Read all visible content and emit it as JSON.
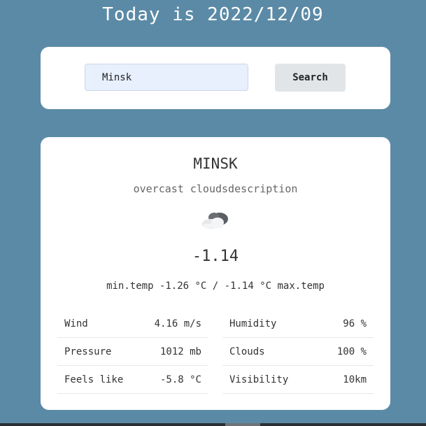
{
  "header": {
    "title": "Today is 2022/12/09"
  },
  "search": {
    "value": "Minsk",
    "placeholder": "",
    "button_label": "Search"
  },
  "weather": {
    "city": "MINSK",
    "description": "overcast cloudsdescription",
    "icon": "cloud-icon",
    "temperature": "-1.14",
    "minmax": "min.temp -1.26 °C / -1.14 °C max.temp"
  },
  "details": {
    "left": [
      {
        "label": "Wind",
        "value": "4.16 m/s"
      },
      {
        "label": "Pressure",
        "value": "1012 mb"
      },
      {
        "label": "Feels like",
        "value": "-5.8 °C"
      }
    ],
    "right": [
      {
        "label": "Humidity",
        "value": "96 %"
      },
      {
        "label": "Clouds",
        "value": "100 %"
      },
      {
        "label": "Visibility",
        "value": "10km"
      }
    ]
  },
  "colors": {
    "background": "#5b8aa6",
    "card": "#ffffff",
    "input_bg": "#e8f0fe",
    "button_bg": "#e2e5e8"
  }
}
